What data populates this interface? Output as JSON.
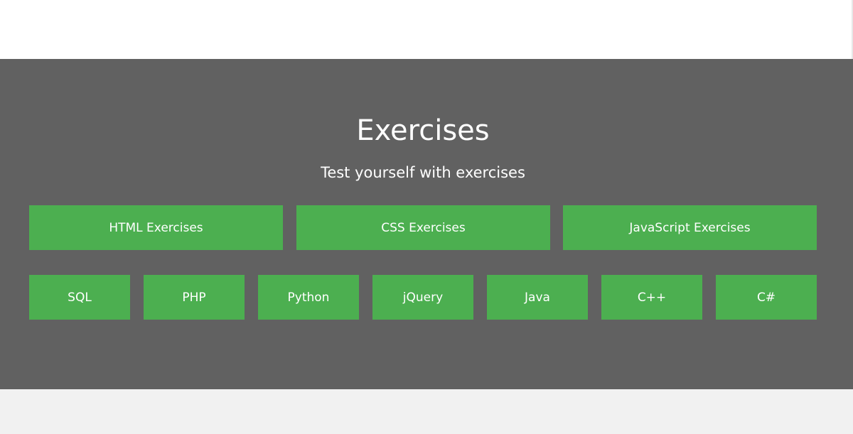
{
  "section": {
    "title": "Exercises",
    "subtitle": "Test yourself with exercises"
  },
  "main_buttons": [
    {
      "label": "HTML Exercises"
    },
    {
      "label": "CSS Exercises"
    },
    {
      "label": "JavaScript Exercises"
    }
  ],
  "language_buttons": [
    {
      "label": "SQL"
    },
    {
      "label": "PHP"
    },
    {
      "label": "Python"
    },
    {
      "label": "jQuery"
    },
    {
      "label": "Java"
    },
    {
      "label": "C++"
    },
    {
      "label": "C#"
    }
  ],
  "colors": {
    "band_background": "#616161",
    "button_background": "#4caf50",
    "text": "#ffffff"
  }
}
